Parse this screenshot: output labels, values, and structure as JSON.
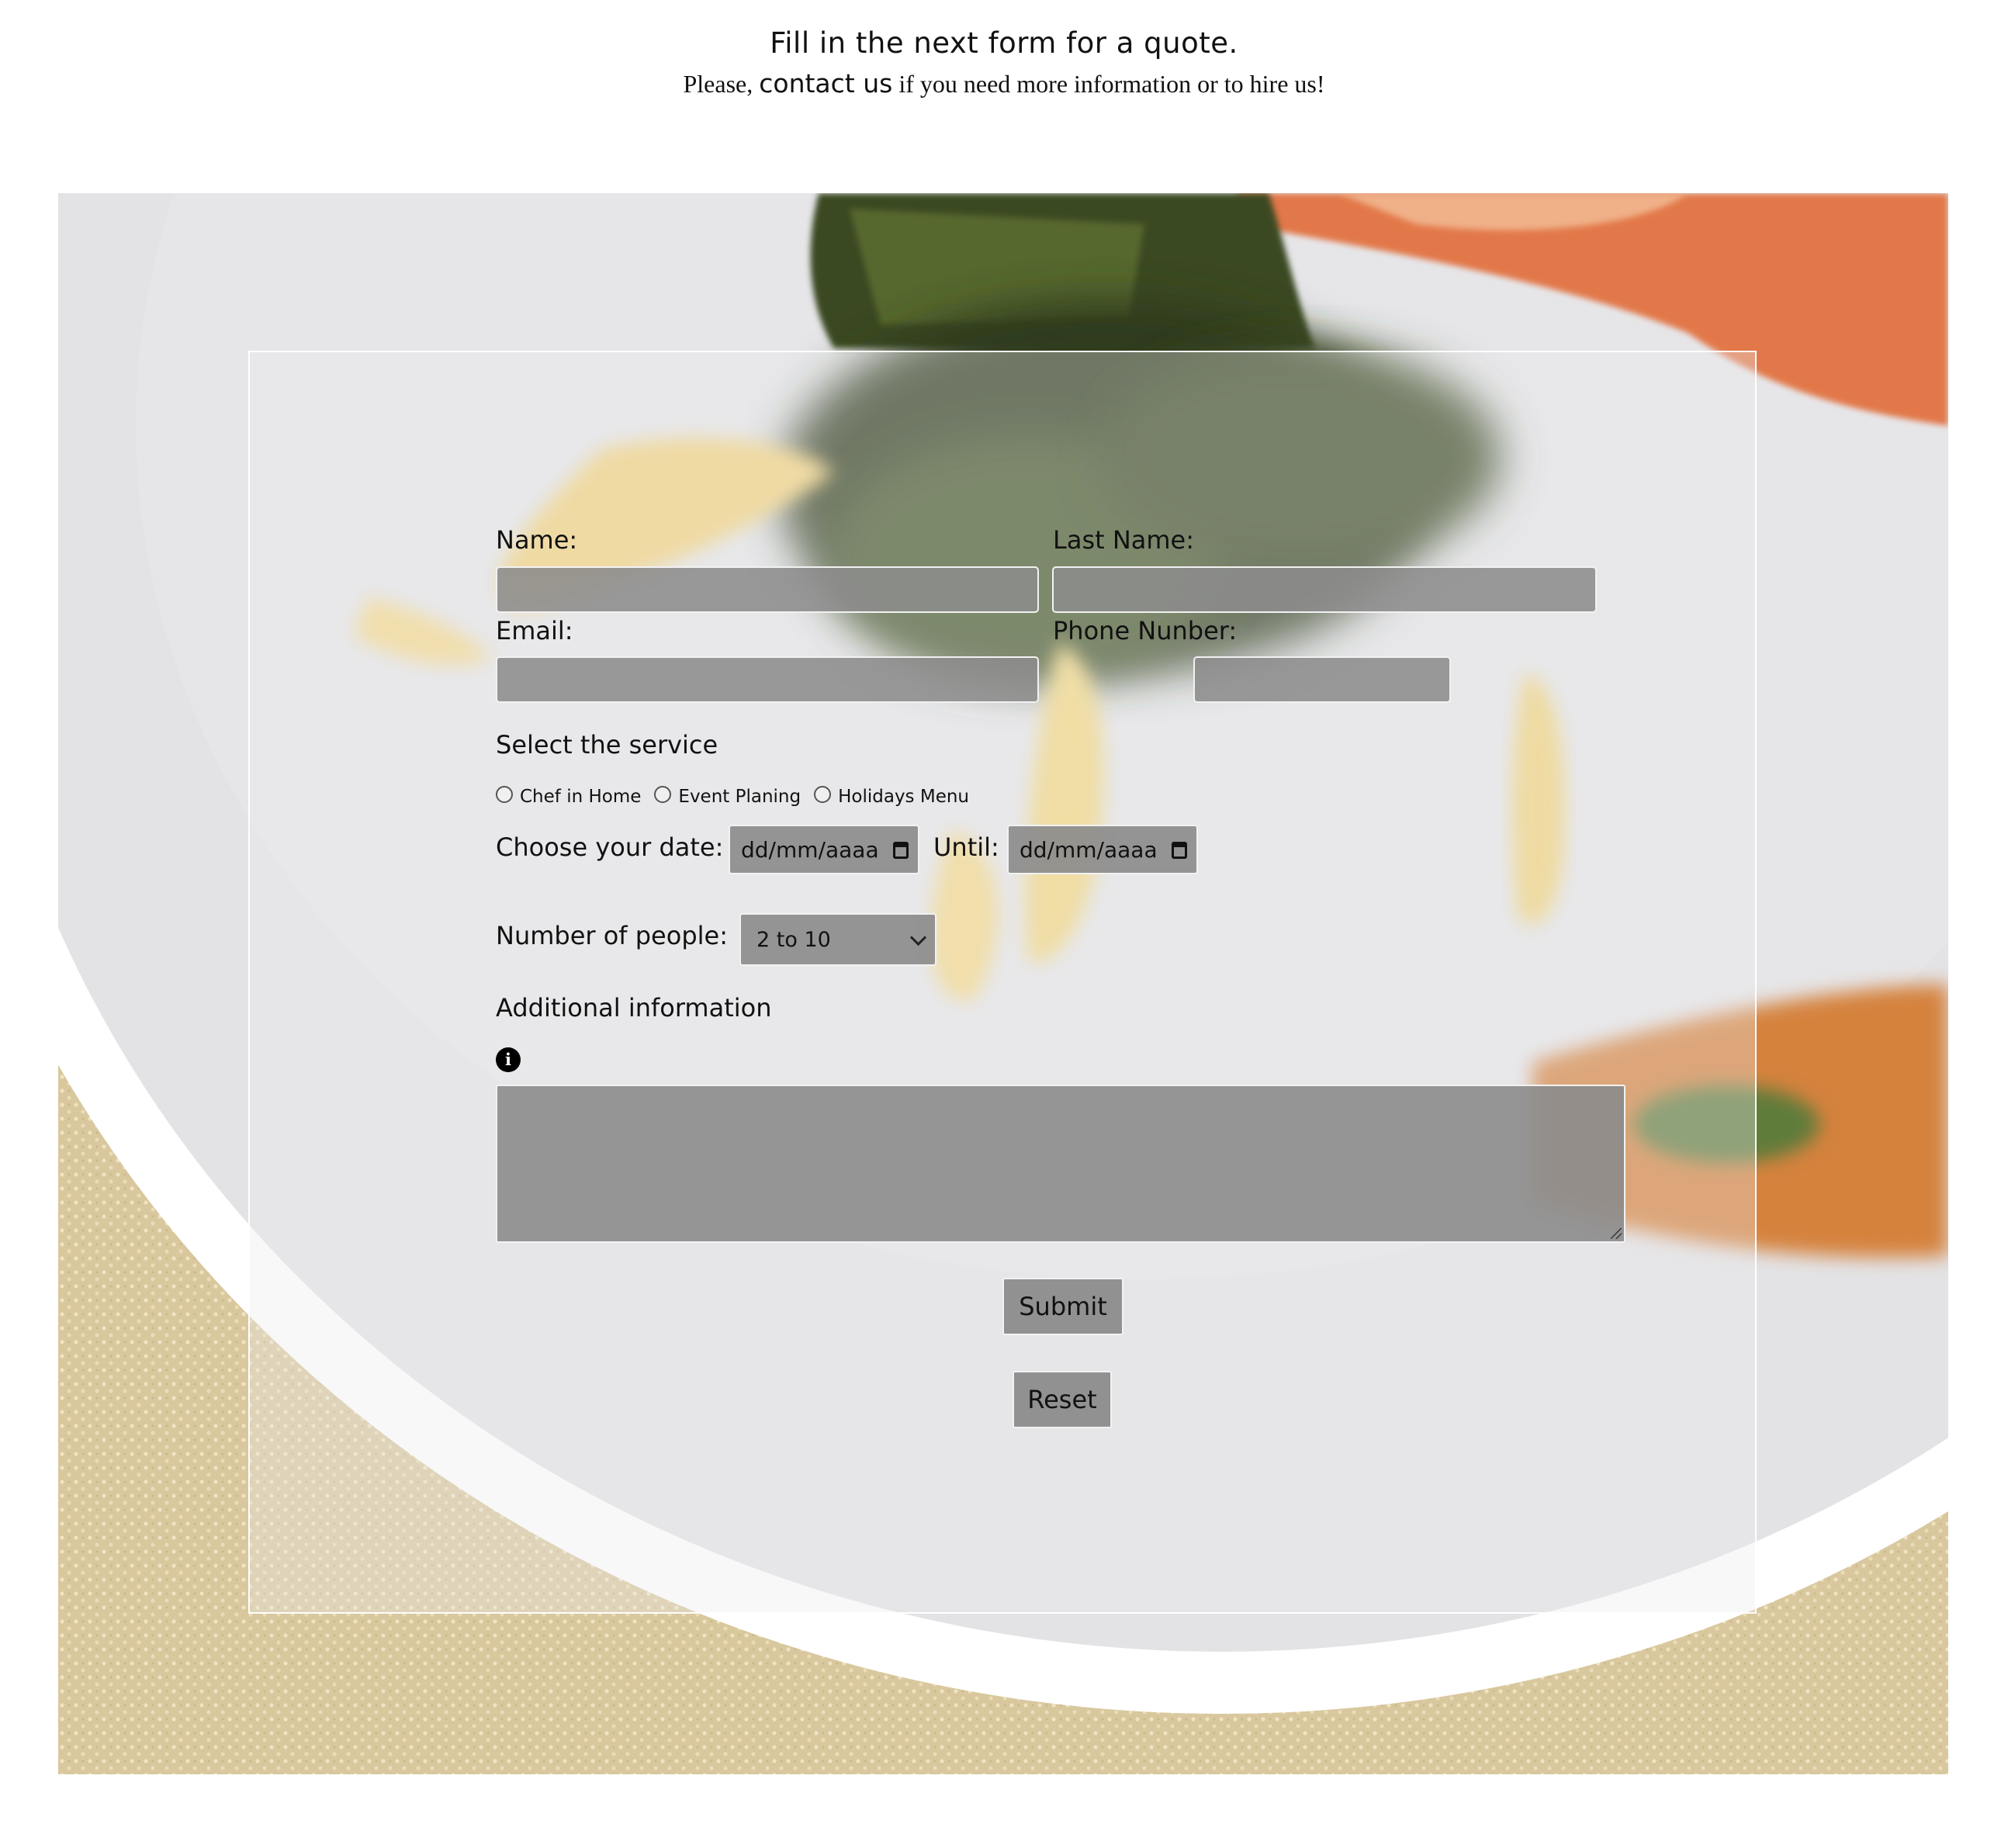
{
  "header": {
    "title": "Fill in the next form for a quote.",
    "subtitle_before": "Please, ",
    "contact_link": "contact us",
    "subtitle_after": " if you need more information or to hire us!"
  },
  "form": {
    "name_label": "Name:",
    "last_name_label": "Last Name:",
    "email_label": "Email:",
    "phone_label": "Phone Nunber:",
    "service_label": "Select the service",
    "services": [
      "Chef in Home",
      "Event Planing",
      "Holidays Menu"
    ],
    "date_label": "Choose your date:",
    "date_placeholder": "dd/mm/aaaa",
    "until_label": "Until:",
    "until_placeholder": "dd/mm/aaaa",
    "people_label": "Number of people:",
    "people_selected": "2 to 10",
    "additional_label": "Additional information",
    "info_glyph": "i",
    "submit_label": "Submit",
    "reset_label": "Reset"
  },
  "icons": {
    "info": "info-icon",
    "calendar": "calendar-icon",
    "select_arrow": "chevron-down-icon",
    "resize": "resize-grip-icon"
  },
  "colors": {
    "input_fill": "#8c8c8c",
    "panel_border": "#ffffff",
    "text": "#111111"
  }
}
